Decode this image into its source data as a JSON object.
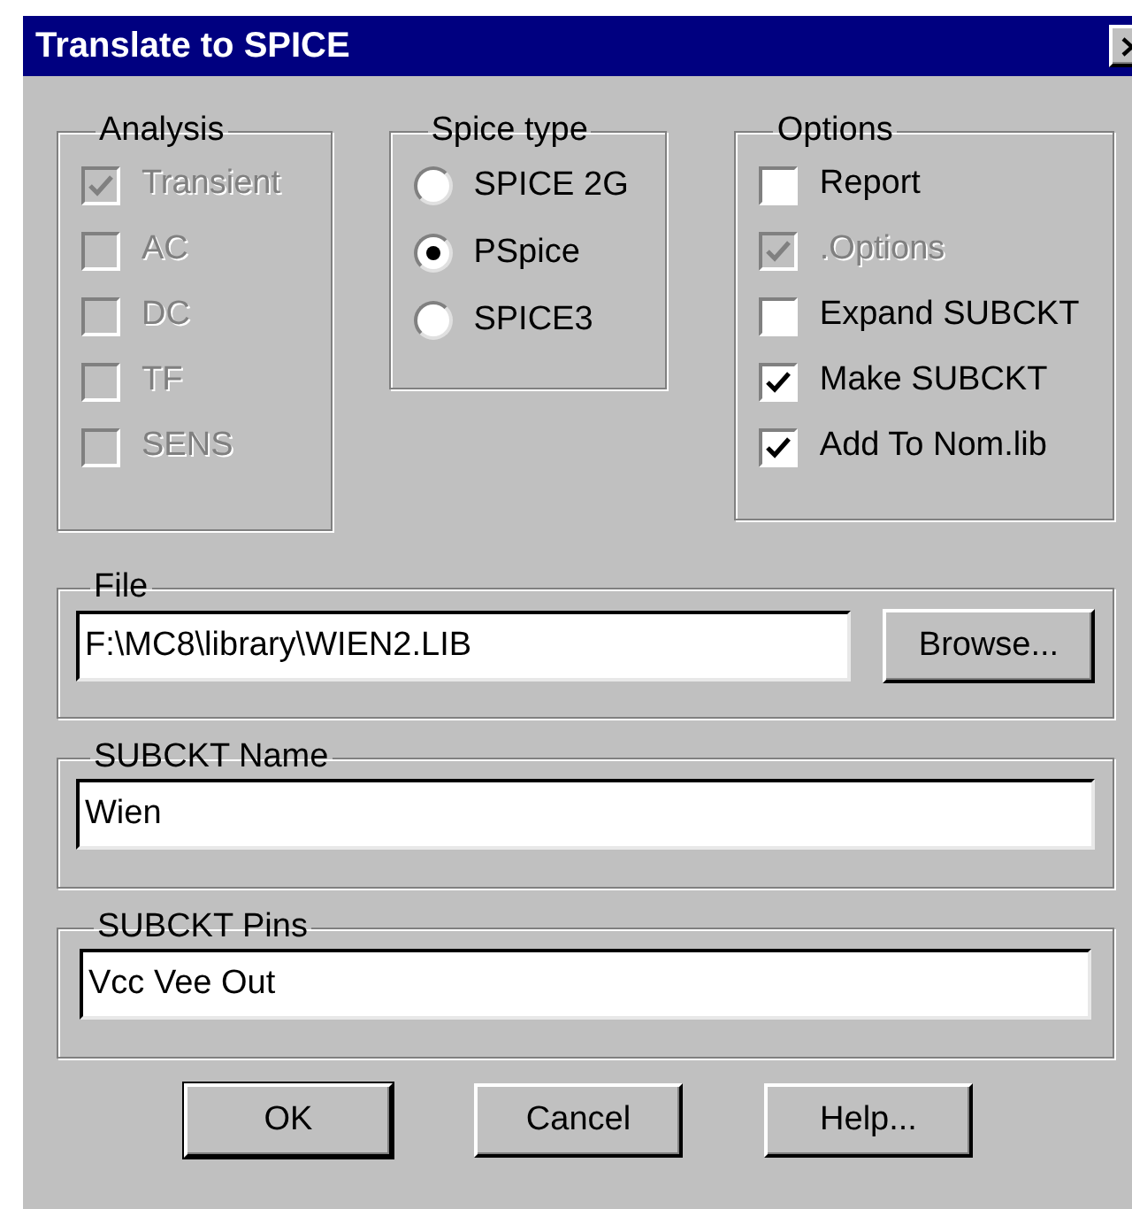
{
  "window": {
    "title": "Translate to SPICE"
  },
  "analysis": {
    "label": "Analysis",
    "items": [
      {
        "label": "Transient",
        "checked": true,
        "disabled": true
      },
      {
        "label": "AC",
        "checked": false,
        "disabled": true
      },
      {
        "label": "DC",
        "checked": false,
        "disabled": true
      },
      {
        "label": "TF",
        "checked": false,
        "disabled": true
      },
      {
        "label": "SENS",
        "checked": false,
        "disabled": true
      }
    ]
  },
  "spice_type": {
    "label": "Spice type",
    "items": [
      {
        "label": "SPICE 2G",
        "selected": false
      },
      {
        "label": "PSpice",
        "selected": true
      },
      {
        "label": "SPICE3",
        "selected": false
      }
    ]
  },
  "options": {
    "label": "Options",
    "items": [
      {
        "label": "Report",
        "checked": false,
        "disabled": false
      },
      {
        "label": ".Options",
        "checked": true,
        "disabled": true
      },
      {
        "label": "Expand SUBCKT",
        "checked": false,
        "disabled": false
      },
      {
        "label": "Make SUBCKT",
        "checked": true,
        "disabled": false
      },
      {
        "label": "Add To Nom.lib",
        "checked": true,
        "disabled": false
      }
    ]
  },
  "file": {
    "label": "File",
    "value": "F:\\MC8\\library\\WIEN2.LIB",
    "browse_button": "Browse..."
  },
  "subckt_name": {
    "label": "SUBCKT Name",
    "value": "Wien"
  },
  "subckt_pins": {
    "label": "SUBCKT Pins",
    "value": "Vcc Vee Out"
  },
  "buttons": [
    {
      "label": "OK",
      "default": true
    },
    {
      "label": "Cancel",
      "default": false
    },
    {
      "label": "Help...",
      "default": false
    }
  ]
}
